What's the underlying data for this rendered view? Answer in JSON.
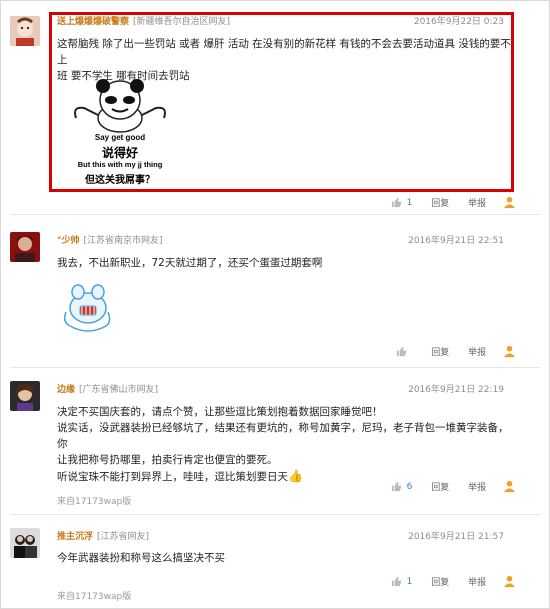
{
  "comments": [
    {
      "user": "送上爆爆爆破警察",
      "location": "[新疆维吾尔自治区网友]",
      "time": "2016年9月22日 0:23",
      "text_lines": [
        "这帮脑残 除了出一些罚站 或者 爆肝 活动 在没有别的新花样 有钱的不会去要活动道具 没钱的要不上",
        "班 要不学生 哪有时间去罚站"
      ],
      "meme": {
        "line1": "Say get good",
        "line2": "说得好",
        "line3": "But this with my jj thing",
        "line4": "但这关我屌事？"
      },
      "likes": "1",
      "reply": "回复",
      "report": "举报"
    },
    {
      "user": "°少帅",
      "location": "[江苏省南京市网友]",
      "time": "2016年9月21日 22:51",
      "text_lines": [
        "我去，不出新职业，72天就过期了，还买个蛋蛋过期套啊"
      ],
      "likes": "",
      "reply": "回复",
      "report": "举报"
    },
    {
      "user": "边缘",
      "location": "[广东省佛山市网友]",
      "time": "2016年9月21日 22:19",
      "text_lines": [
        "决定不买国庆套的，请点个赞，让那些逗比策划抱着数据回家睡觉吧！",
        "说实话，没武器装扮已经够坑了，结果还有更坑的，称号加黄字，尼玛，老子背包一堆黄字装备，你",
        "让我把称号扔哪里，拍卖行肯定也便宜的要死。",
        "听说宝珠不能打到异界上，哇哇，逗比策划要日天"
      ],
      "source": "来自17173wap版",
      "likes": "6",
      "reply": "回复",
      "report": "举报"
    },
    {
      "user": "推主沉浮",
      "location": "[江苏省网友]",
      "time": "2016年9月21日 21:57",
      "text_lines": [
        "今年武器装扮和称号这么搞坚决不买"
      ],
      "source": "来自17173wap版",
      "likes": "1",
      "reply": "回复",
      "report": "举报"
    }
  ],
  "colors": {
    "username": "#c87a18",
    "highlight": "#d80000",
    "like": "#3a7fd5",
    "report": "#f0a028"
  }
}
